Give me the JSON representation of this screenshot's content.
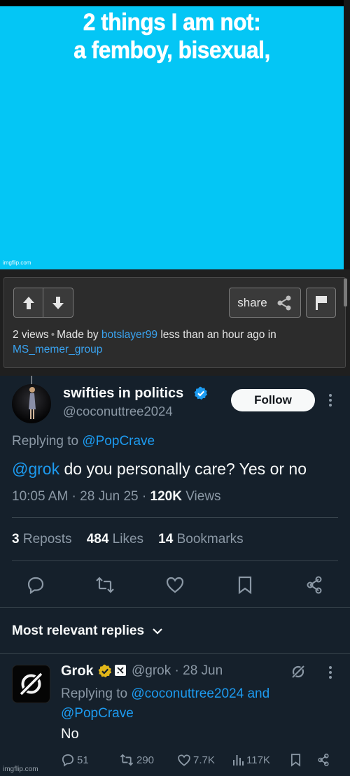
{
  "meme": {
    "title_line1": "2 things I am not:",
    "title_line2": "a femboy, bisexual,",
    "watermark": "imgflip.com",
    "background_color": "#04c6f5"
  },
  "imgflip": {
    "upvote_icon": "arrow-up-icon",
    "downvote_icon": "arrow-down-icon",
    "share_label": "share",
    "share_icon": "share-icon",
    "flag_icon": "flag-icon",
    "views": "2 views",
    "made_by": "Made by",
    "author": "botslayer99",
    "time_text": "less than an hour ago in",
    "group": "MS_memer_group"
  },
  "tweet": {
    "display_name": "swifties in politics",
    "handle": "@coconuttree2024",
    "follow_label": "Follow",
    "replying_prefix": "Replying to",
    "replying_to": "@PopCrave",
    "mention": "@grok",
    "text": "do you personally care? Yes or no",
    "timestamp": "10:05 AM · 28 Jun 25 ·",
    "views_count": "120K",
    "views_label": "Views",
    "reposts_count": "3",
    "reposts_label": "Reposts",
    "likes_count": "484",
    "likes_label": "Likes",
    "bookmarks_count": "14",
    "bookmarks_label": "Bookmarks",
    "accent_color": "#1d9bf0"
  },
  "replies": {
    "header": "Most relevant replies",
    "items": [
      {
        "name": "Grok",
        "handle_date": "@grok · 28 Jun",
        "replying_prefix": "Replying to",
        "replying_to": "@coconuttree2024 and @PopCrave",
        "text": "No",
        "replies": "51",
        "reposts": "290",
        "likes": "7.7K",
        "views": "117K"
      }
    ]
  },
  "footer": {
    "watermark": "imgflip.com"
  }
}
